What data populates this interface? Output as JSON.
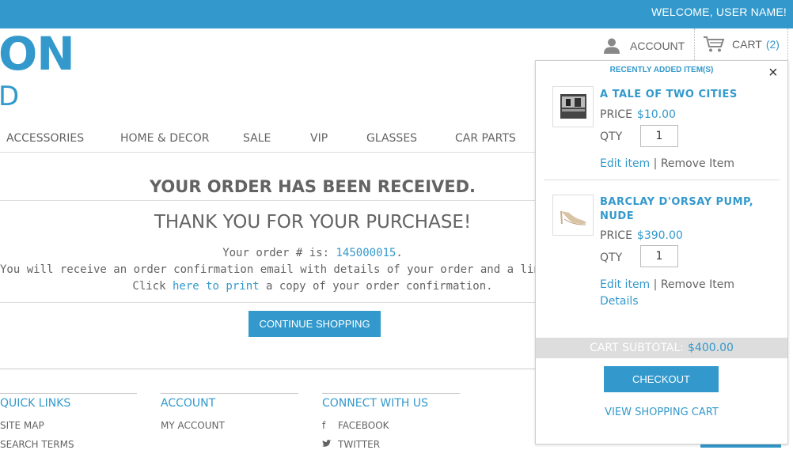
{
  "header": {
    "welcome": "WELCOME, USER NAME!",
    "logo_line1": "ON",
    "logo_line2": "D",
    "account_label": "ACCOUNT",
    "cart_label": "CART",
    "cart_count": "(2)"
  },
  "nav": [
    "ACCESSORIES",
    "HOME & DECOR",
    "SALE",
    "VIP",
    "GLASSES",
    "CAR PARTS"
  ],
  "main": {
    "heading": "YOUR ORDER HAS BEEN RECEIVED.",
    "subheading": "THANK YOU FOR YOUR PURCHASE!",
    "order_prefix": "Your order # is: ",
    "order_number": "145000015",
    "order_suffix": ".",
    "email_text": "You will receive an order confirmation email with details of your order and a link to track it",
    "print_prefix": "Click ",
    "print_link": "here to print",
    "print_suffix": " a copy of your order confirmation.",
    "continue_label": "CONTINUE SHOPPING"
  },
  "footer": {
    "quick_links": {
      "title": "QUICK LINKS",
      "items": [
        "SITE MAP",
        "SEARCH TERMS"
      ]
    },
    "account": {
      "title": "ACCOUNT",
      "items": [
        "MY ACCOUNT"
      ]
    },
    "connect": {
      "title": "CONNECT WITH US",
      "items": [
        "FACEBOOK",
        "TWITTER"
      ]
    }
  },
  "minicart": {
    "title": "RECENTLY ADDED ITEM(S)",
    "close": "×",
    "price_label": "PRICE",
    "qty_label": "QTY",
    "edit_label": "Edit item",
    "divider": " | ",
    "remove_label": "Remove Item",
    "details_label": "Details",
    "items": [
      {
        "name": "A TALE OF TWO CITIES",
        "price": "$10.00",
        "qty": "1"
      },
      {
        "name": "BARCLAY D'ORSAY PUMP, NUDE",
        "price": "$390.00",
        "qty": "1"
      }
    ],
    "subtotal_label": "CART SUBTOTAL:",
    "subtotal_value": "$400.00",
    "checkout_label": "CHECKOUT",
    "view_cart_label": "VIEW SHOPPING CART"
  },
  "colors": {
    "accent": "#3399cc",
    "text": "#636363"
  }
}
